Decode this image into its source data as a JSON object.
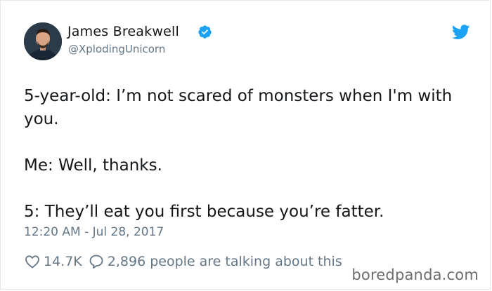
{
  "tweet": {
    "author": {
      "display_name": "James Breakwell",
      "handle": "@XplodingUnicorn",
      "verified": true
    },
    "text_lines": [
      "5-year-old: I’m not scared of monsters when I'm with you.",
      "Me: Well, thanks.",
      "5: They’ll eat you first because you’re fatter."
    ],
    "timestamp": "12:20 AM - Jul 28, 2017",
    "likes": "14.7K",
    "replies_text": "2,896 people are talking about this"
  },
  "icons": {
    "verified": "verified-badge-icon",
    "platform": "twitter-bird-icon",
    "like": "heart-icon",
    "reply": "speech-bubble-icon"
  },
  "colors": {
    "twitter_blue": "#1da1f2",
    "text_primary": "#14171a",
    "text_secondary": "#657786"
  },
  "watermark": "boredpanda.com"
}
